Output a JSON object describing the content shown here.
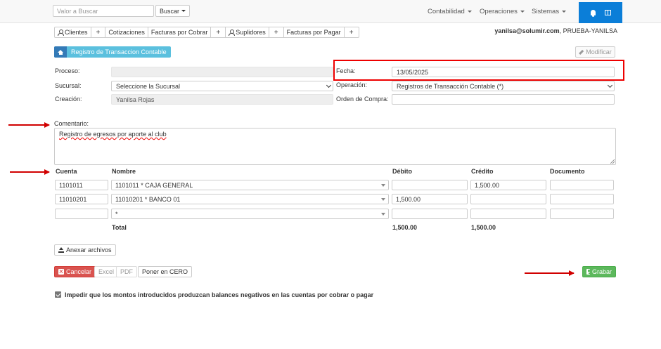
{
  "topbar": {
    "search_placeholder": "Valor a Buscar",
    "search_button": "Buscar",
    "nav": [
      "Contabilidad",
      "Operaciones",
      "Sistemas"
    ],
    "accent": "#0b7ed8"
  },
  "tabs": [
    "Clientes",
    "Cotizaciones",
    "Facturas por Cobrar",
    "Suplidores",
    "Facturas por Pagar"
  ],
  "account": {
    "email": "yanilsa@solumir.com",
    "company": ", PRUEBA-YANILSA"
  },
  "header": {
    "title": "Registro de Transaccion Contable",
    "edit_button": "Modificar"
  },
  "form": {
    "proceso_label": "Proceso:",
    "proceso_value": "",
    "sucursal_label": "Sucursal:",
    "sucursal_value": "Seleccione la Sucursal",
    "creacion_label": "Creación:",
    "creacion_value": "Yanilsa Rojas",
    "fecha_label": "Fecha:",
    "fecha_value": "13/05/2025",
    "operacion_label": "Operación:",
    "operacion_value": "Registros de Transacción Contable (*)",
    "orden_label": "Orden de Compra:",
    "orden_value": "",
    "comentario_label": "Comentario:",
    "comentario_value": "Registro de egresos por aporte al club"
  },
  "table": {
    "headers": {
      "cuenta": "Cuenta",
      "nombre": "Nombre",
      "debito": "Débito",
      "credito": "Crédito",
      "documento": "Documento"
    },
    "rows": [
      {
        "cuenta": "1101011",
        "nombre": "1101011 * CAJA GENERAL",
        "debito": "",
        "credito": "1,500.00",
        "documento": ""
      },
      {
        "cuenta": "11010201",
        "nombre": "11010201 * BANCO 01",
        "debito": "1,500.00",
        "credito": "",
        "documento": ""
      },
      {
        "cuenta": "",
        "nombre": "*",
        "debito": "",
        "credito": "",
        "documento": ""
      }
    ],
    "total_label": "Total",
    "total_debito": "1,500.00",
    "total_credito": "1,500.00"
  },
  "actions": {
    "attach": "Anexar archivos",
    "cancel": "Cancelar",
    "excel": "Excel",
    "pdf": "PDF",
    "zero": "Poner en CERO",
    "save": "Grabar"
  },
  "option": {
    "label": "Impedir que los montos introducidos produzcan balances negativos en las cuentas por cobrar o pagar",
    "checked": true
  }
}
